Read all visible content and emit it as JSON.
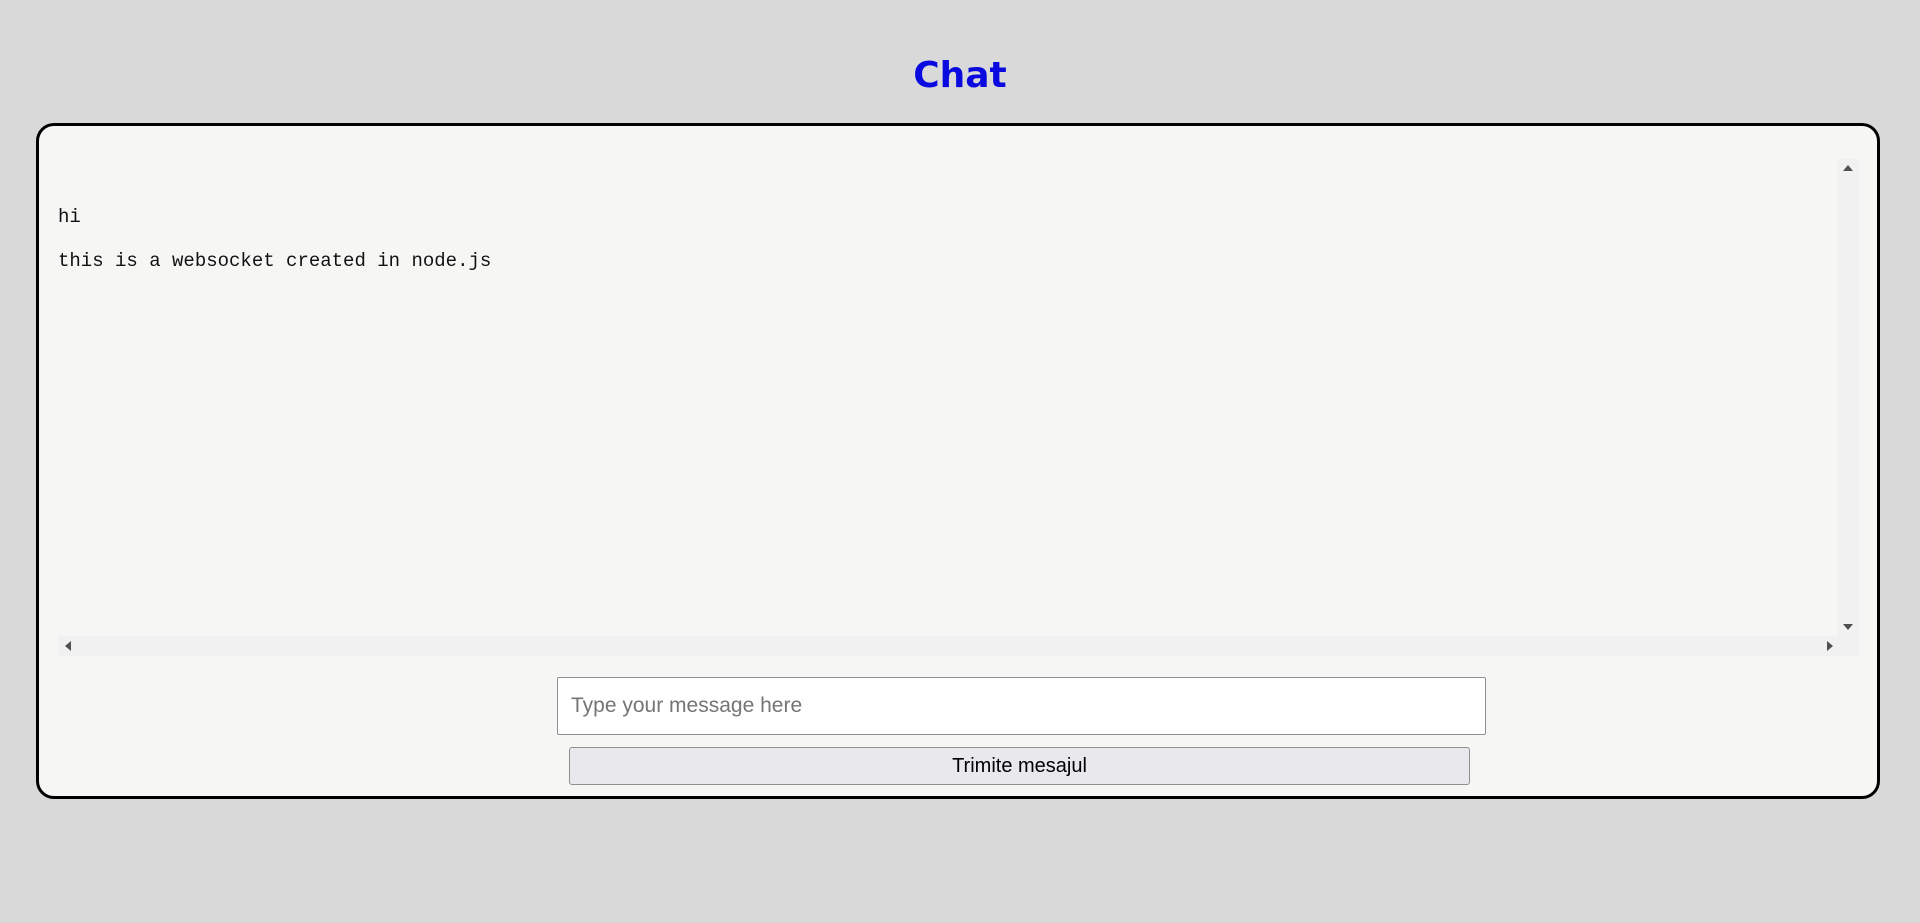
{
  "header": {
    "title": "Chat"
  },
  "chat": {
    "messages": [
      {
        "text": "hi"
      },
      {
        "text": "this is a websocket created in node.js"
      }
    ]
  },
  "composer": {
    "input_value": "",
    "input_placeholder": "Type your message here",
    "send_label": "Trimite mesajul"
  },
  "colors": {
    "page_background": "#d9d9d9",
    "title_color": "#0a0ae0",
    "panel_background": "#f6f7f5",
    "panel_border": "#000000",
    "button_background": "#e9e9ed"
  },
  "icons": {
    "scroll_up": "chevron-up-icon",
    "scroll_down": "chevron-down-icon",
    "scroll_left": "chevron-left-icon",
    "scroll_right": "chevron-right-icon"
  }
}
